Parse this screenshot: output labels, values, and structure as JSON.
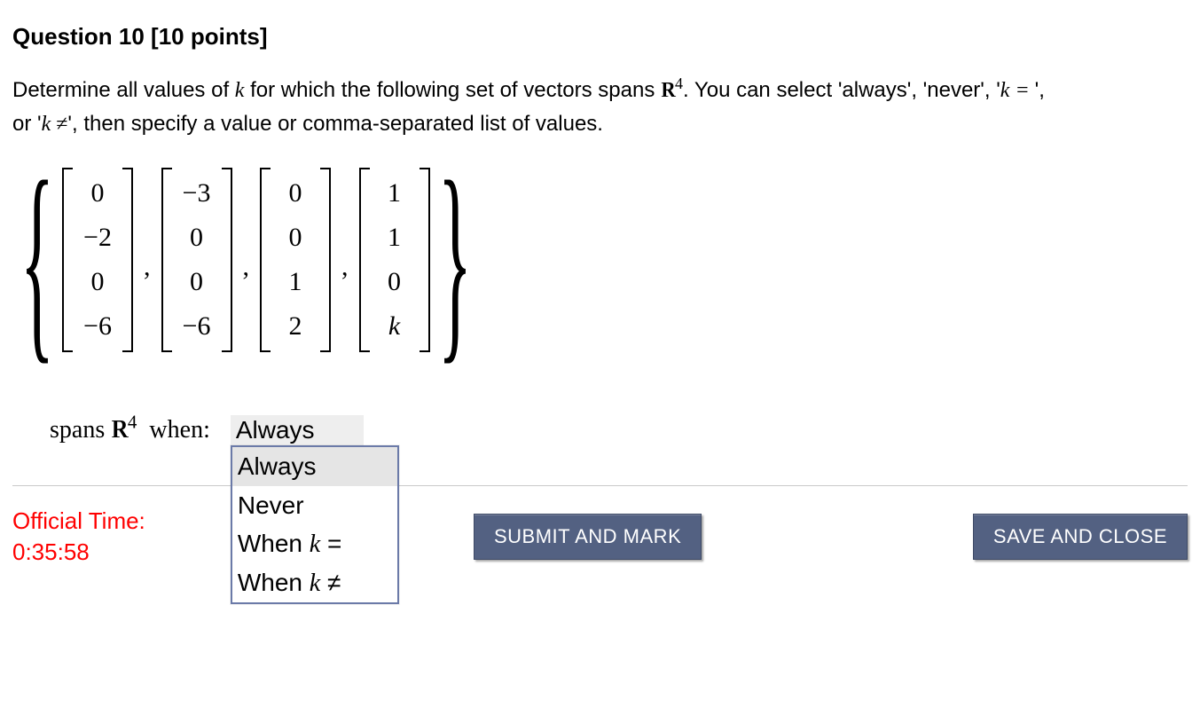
{
  "question": {
    "title": "Question 10 [10 points]",
    "prompt_part1": "Determine all values of ",
    "var_k": "k",
    "prompt_part2": " for which the following set of vectors spans ",
    "space": {
      "letter": "R",
      "exp": "4"
    },
    "prompt_part3": ". You can select 'always', 'never', '",
    "opt_keq": "k = ",
    "prompt_part4": "', or '",
    "opt_kneq_pre": "k ",
    "opt_kneq_sym": "≠",
    "prompt_part5": "', then specify a value or comma-separated list of values."
  },
  "vectors": [
    [
      "0",
      "−2",
      "0",
      "−6"
    ],
    [
      "−3",
      "0",
      "0",
      "−6"
    ],
    [
      "0",
      "0",
      "1",
      "2"
    ],
    [
      "1",
      "1",
      "0",
      "k"
    ]
  ],
  "answer": {
    "label_pre": "spans ",
    "space": {
      "letter": "R",
      "exp": "4"
    },
    "label_post": "  when: ",
    "selected": "Always",
    "options": [
      {
        "text": "Always",
        "highlighted": true
      },
      {
        "text": "Never"
      },
      {
        "text_pre": "When ",
        "math": "k",
        "text_post": " ="
      },
      {
        "text_pre": "When ",
        "math": "k",
        "text_post": " ≠"
      }
    ]
  },
  "footer": {
    "time_label": "Official Time:",
    "time_value": "0:35:58",
    "submit": "SUBMIT AND MARK",
    "save": "SAVE AND CLOSE"
  }
}
